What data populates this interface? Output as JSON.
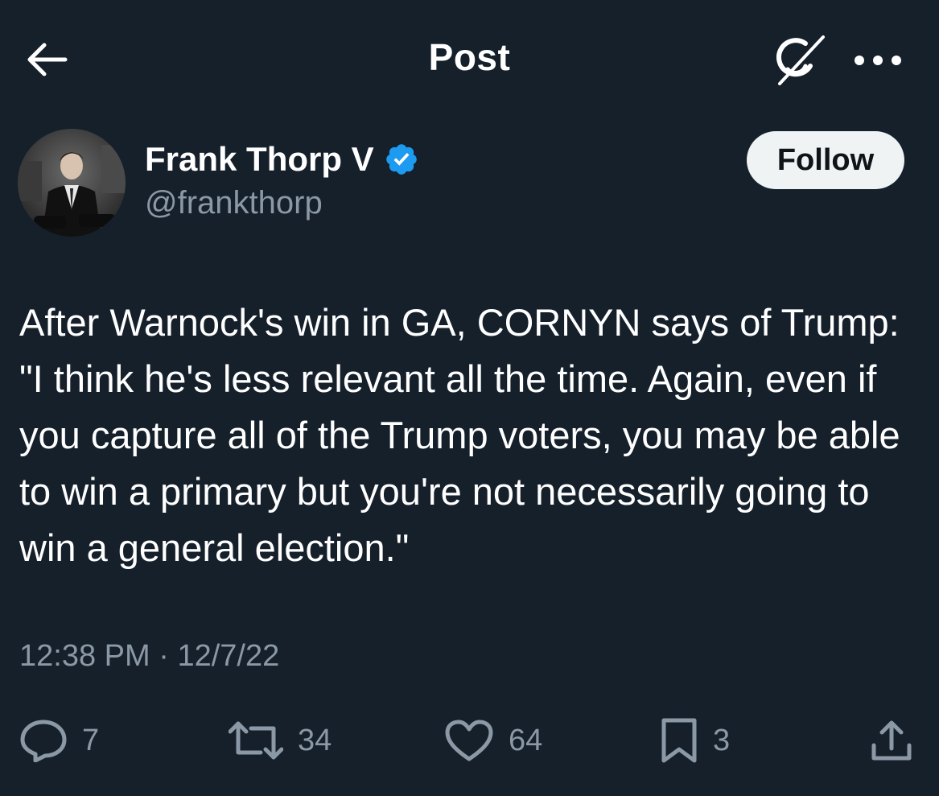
{
  "header": {
    "title": "Post"
  },
  "author": {
    "name": "Frank Thorp V",
    "handle": "@frankthorp"
  },
  "follow_label": "Follow",
  "post": {
    "text": "After Warnock's win in GA, CORNYN says of Trump: \"I think he's less relevant all the time. Again, even if you capture all of the Trump voters, you may be able to win a primary but you're not necessarily going to win a general election.\"",
    "time": "12:38 PM",
    "separator": "·",
    "date": "12/7/22"
  },
  "actions": {
    "replies": "7",
    "reposts": "34",
    "likes": "64",
    "bookmarks": "3"
  },
  "colors": {
    "background": "#15202b",
    "text": "#ffffff",
    "muted": "#8b98a5",
    "verified": "#1d9bf0",
    "follow_bg": "#eff3f4"
  },
  "icons": {
    "back": "arrow-left-icon",
    "grok": "grok-icon",
    "more": "more-dots-icon",
    "verified": "verified-badge-icon",
    "reply": "reply-icon",
    "repost": "repost-icon",
    "like": "heart-icon",
    "bookmark": "bookmark-icon",
    "share": "share-icon"
  }
}
